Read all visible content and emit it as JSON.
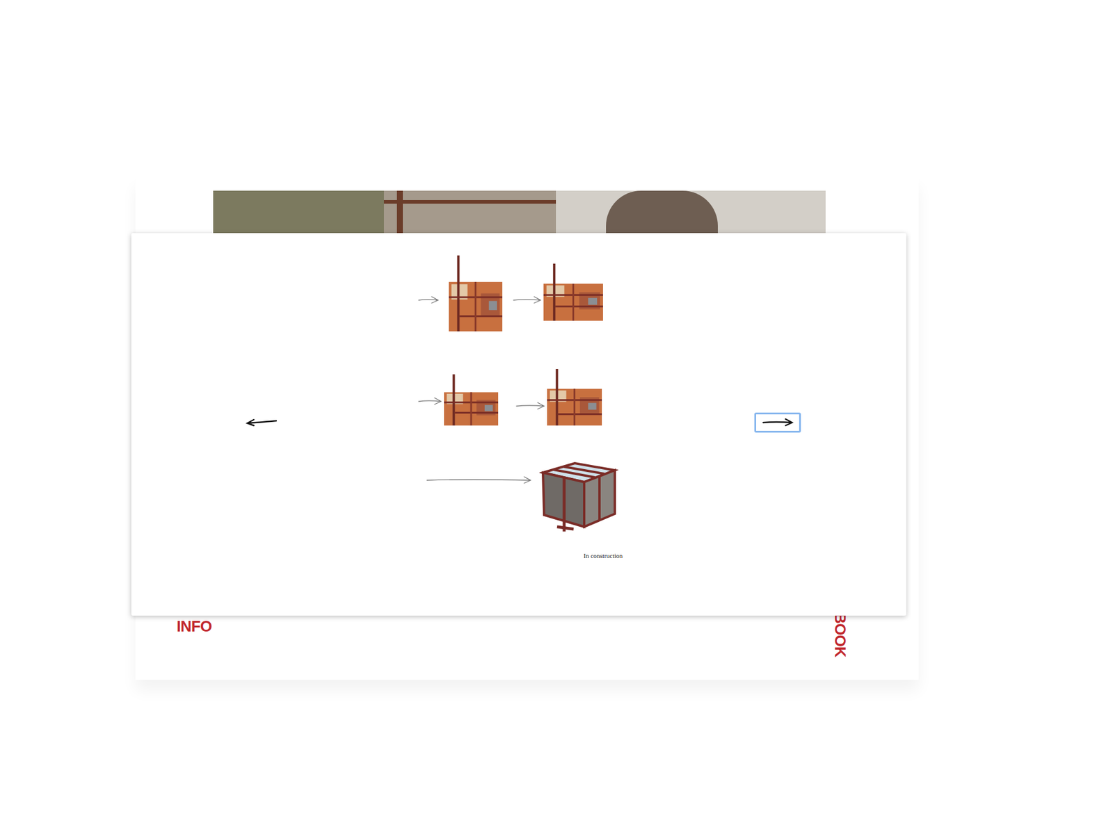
{
  "gallery": {
    "caption": "In construction",
    "prev_button": {
      "focused": false
    },
    "next_button": {
      "focused": true
    }
  },
  "nav": {
    "info": "INFO",
    "book": "BOOK"
  }
}
